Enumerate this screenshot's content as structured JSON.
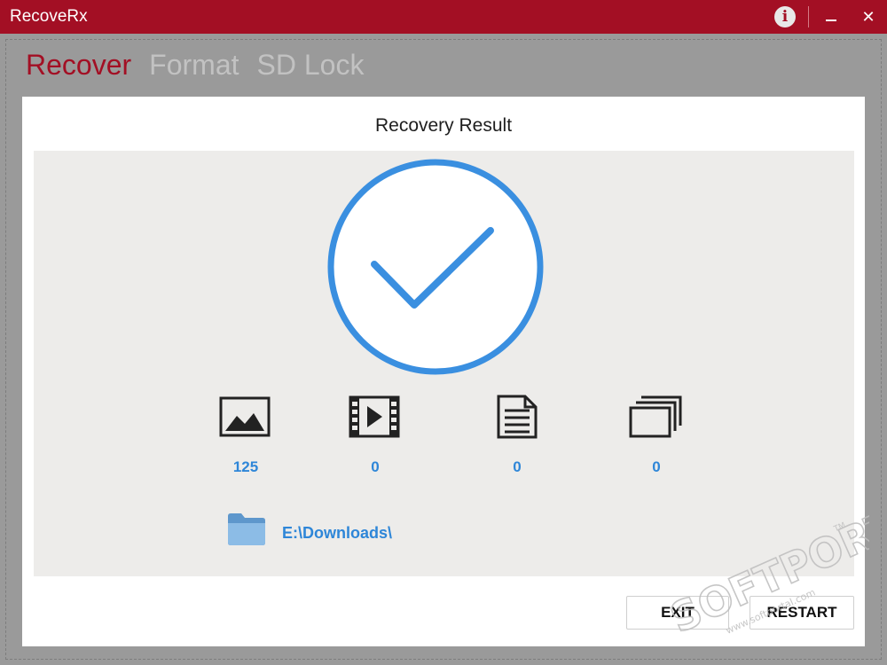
{
  "app": {
    "title": "RecoveRx"
  },
  "titlebar": {
    "info_icon": "info-icon",
    "info_glyph": "i",
    "close_glyph": "✕"
  },
  "nav": {
    "tabs": [
      {
        "label": "Recover",
        "active": true
      },
      {
        "label": "Format",
        "active": false
      },
      {
        "label": "SD Lock",
        "active": false
      }
    ]
  },
  "result": {
    "title": "Recovery Result",
    "status_icon": "checkmark-circle-icon",
    "stats": [
      {
        "icon": "image-icon",
        "value": "125"
      },
      {
        "icon": "video-icon",
        "value": "0"
      },
      {
        "icon": "document-icon",
        "value": "0"
      },
      {
        "icon": "other-files-icon",
        "value": "0"
      }
    ],
    "path": "E:\\Downloads\\"
  },
  "buttons": {
    "exit": "EXIT",
    "restart": "RESTART"
  },
  "watermark": {
    "text": "SOFTPORTAL",
    "url": "www.softportal.com",
    "tm": "TM"
  },
  "colors": {
    "brand": "#a30f24",
    "accent": "#2e86d8",
    "panel": "#edecea"
  }
}
